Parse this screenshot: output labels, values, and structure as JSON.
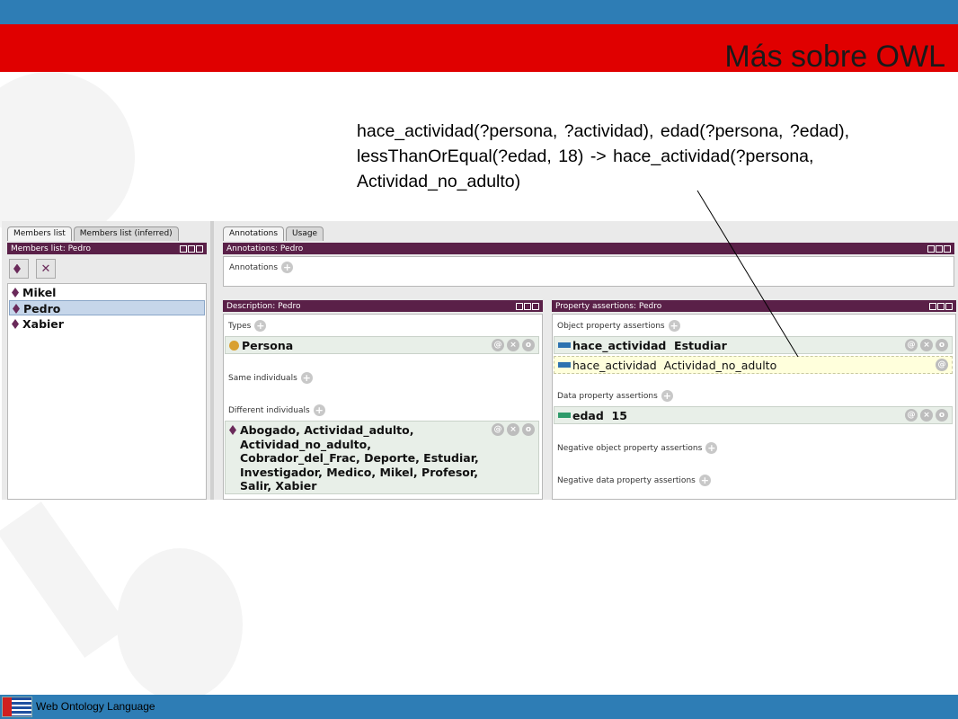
{
  "slide": {
    "title": "Más sobre OWL",
    "rule": "hace_actividad(?persona, ?actividad), edad(?persona, ?edad), lessThanOrEqual(?edad, 18) -> hace_actividad(?persona, Actividad_no_adulto)",
    "footer": "Web Ontology Language"
  },
  "colors": {
    "header_blue": "#2e7db5",
    "title_red": "#e00000",
    "panel_header": "#5a2048"
  },
  "left": {
    "tabs": [
      "Members list",
      "Members list (inferred)"
    ],
    "header": "Members list: Pedro",
    "members": [
      "Mikel",
      "Pedro",
      "Xabier"
    ],
    "selected": "Pedro"
  },
  "annotations": {
    "tabs": [
      "Annotations",
      "Usage"
    ],
    "header": "Annotations: Pedro",
    "label": "Annotations"
  },
  "description": {
    "header": "Description: Pedro",
    "types_label": "Types",
    "type_value": "Persona",
    "same_label": "Same individuals",
    "different_label": "Different individuals",
    "different_lines": [
      "Abogado, Actividad_adulto,",
      "Actividad_no_adulto,",
      "Cobrador_del_Frac, Deporte, Estudiar,",
      "Investigador, Medico, Mikel, Profesor,",
      "Salir, Xabier"
    ]
  },
  "properties": {
    "header": "Property assertions: Pedro",
    "object_label": "Object property assertions",
    "object_asserted": "hace_actividad  Estudiar",
    "object_inferred": "hace_actividad  Actividad_no_adulto",
    "data_label": "Data property assertions",
    "data_value": "edad  15",
    "neg_object_label": "Negative object property assertions",
    "neg_data_label": "Negative data property assertions"
  }
}
